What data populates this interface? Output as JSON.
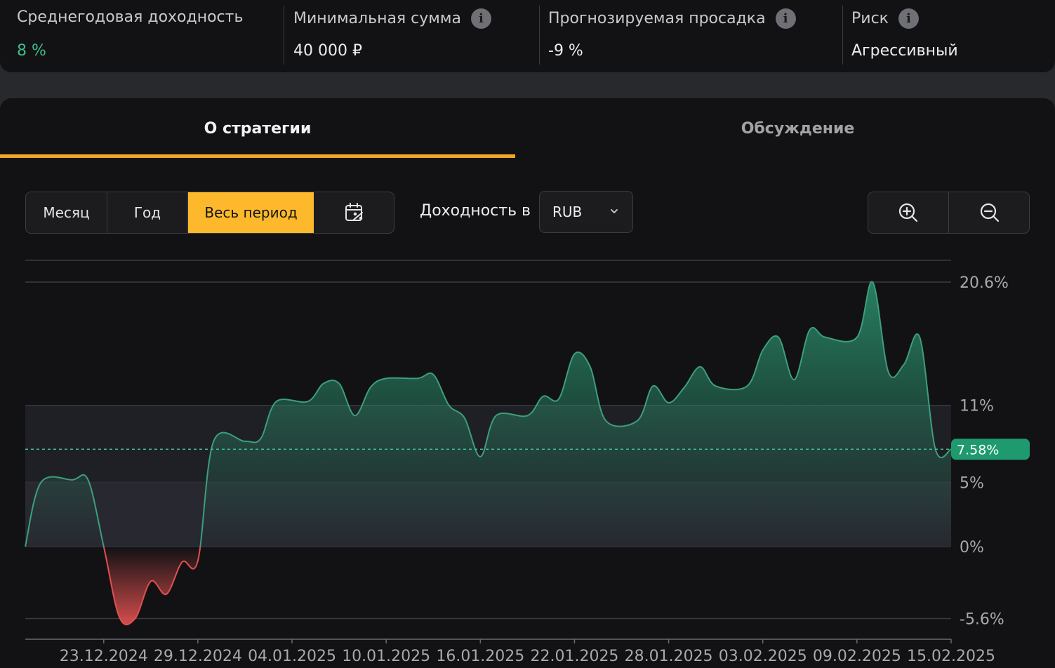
{
  "stats": [
    {
      "label": "Среднегодовая доходность",
      "value": "8 %",
      "has_info": false
    },
    {
      "label": "Минимальная сумма",
      "value": "40 000 ₽",
      "has_info": true
    },
    {
      "label": "Прогнозируемая просадка",
      "value": "-9 %",
      "has_info": true
    },
    {
      "label": "Риск",
      "value": "Агрессивный",
      "has_info": true
    }
  ],
  "info_icon_glyph": "i",
  "tabs": {
    "about": "О стратегии",
    "discussion": "Обсуждение"
  },
  "period": {
    "month": "Месяц",
    "year": "Год",
    "all": "Весь период",
    "selected": "all",
    "calendar_icon": "calendar-percent-icon"
  },
  "yield_label": "Доходность в",
  "currency": {
    "selected": "RUB"
  },
  "zoom": {
    "in_icon": "zoom-in-icon",
    "out_icon": "zoom-out-icon"
  },
  "colors": {
    "accent": "#fdb92b",
    "tab_underline": "#f5a623",
    "positive": "#3fbf8c",
    "line_positive": "#3d9e7c",
    "line_negative": "#e05050",
    "badge": "#1f9a6f"
  },
  "chart_data": {
    "type": "area",
    "y_ticks": [
      {
        "value": 20.6,
        "label": "20.6%"
      },
      {
        "value": 11,
        "label": "11%"
      },
      {
        "value": 5,
        "label": "5%"
      },
      {
        "value": 0,
        "label": "0%"
      },
      {
        "value": -5.6,
        "label": "-5.6%"
      }
    ],
    "ylim": [
      -5.6,
      20.6
    ],
    "x_labels": [
      "23.12.2024",
      "29.12.2024",
      "04.01.2025",
      "10.01.2025",
      "16.01.2025",
      "22.01.2025",
      "28.01.2025",
      "03.02.2025",
      "09.02.2025",
      "15.02.2025"
    ],
    "x_start": "2024-12-18",
    "x_end": "2025-02-15",
    "current_value": 7.58,
    "current_label": "7.58%",
    "series": [
      {
        "points": [
          [
            "2024-12-18",
            0
          ],
          [
            "2024-12-19",
            5.0
          ],
          [
            "2024-12-21",
            5.2
          ],
          [
            "2024-12-22",
            5.2
          ],
          [
            "2024-12-23",
            0
          ],
          [
            "2024-12-24",
            -5.5
          ],
          [
            "2024-12-25",
            -5.6
          ],
          [
            "2024-12-26",
            -2.7
          ],
          [
            "2024-12-27",
            -3.7
          ],
          [
            "2024-12-28",
            -1.2
          ],
          [
            "2024-12-29",
            -1.1
          ],
          [
            "2024-12-30",
            8.2
          ],
          [
            "2025-01-01",
            8.2
          ],
          [
            "2025-01-02",
            8.4
          ],
          [
            "2025-01-03",
            11.3
          ],
          [
            "2025-01-05",
            11.3
          ],
          [
            "2025-01-06",
            12.7
          ],
          [
            "2025-01-07",
            12.7
          ],
          [
            "2025-01-08",
            10.2
          ],
          [
            "2025-01-09",
            12.4
          ],
          [
            "2025-01-10",
            13.1
          ],
          [
            "2025-01-12",
            13.1
          ],
          [
            "2025-01-13",
            13.4
          ],
          [
            "2025-01-14",
            11.0
          ],
          [
            "2025-01-15",
            10.0
          ],
          [
            "2025-01-16",
            7.0
          ],
          [
            "2025-01-17",
            10.2
          ],
          [
            "2025-01-19",
            10.2
          ],
          [
            "2025-01-20",
            11.7
          ],
          [
            "2025-01-21",
            11.5
          ],
          [
            "2025-01-22",
            15.0
          ],
          [
            "2025-01-23",
            14.0
          ],
          [
            "2025-01-24",
            9.8
          ],
          [
            "2025-01-26",
            9.8
          ],
          [
            "2025-01-27",
            12.5
          ],
          [
            "2025-01-28",
            11.2
          ],
          [
            "2025-01-29",
            12.4
          ],
          [
            "2025-01-30",
            14.0
          ],
          [
            "2025-01-31",
            12.5
          ],
          [
            "2025-02-02",
            12.5
          ],
          [
            "2025-02-03",
            15.3
          ],
          [
            "2025-02-04",
            16.3
          ],
          [
            "2025-02-05",
            13.0
          ],
          [
            "2025-02-06",
            16.9
          ],
          [
            "2025-02-07",
            16.3
          ],
          [
            "2025-02-09",
            16.3
          ],
          [
            "2025-02-10",
            20.6
          ],
          [
            "2025-02-11",
            13.6
          ],
          [
            "2025-02-12",
            14.2
          ],
          [
            "2025-02-13",
            16.3
          ],
          [
            "2025-02-14",
            7.58
          ],
          [
            "2025-02-15",
            7.58
          ]
        ]
      }
    ],
    "grid": true
  }
}
